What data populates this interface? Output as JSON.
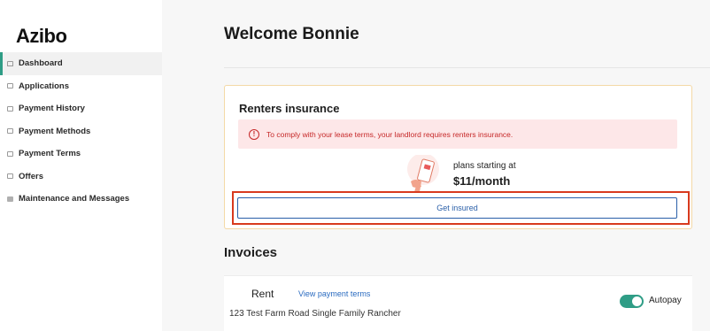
{
  "brand": {
    "logo": "Azibo"
  },
  "sidebar": {
    "items": [
      {
        "label": "Dashboard",
        "icon": "home-icon"
      },
      {
        "label": "Applications",
        "icon": "document-icon"
      },
      {
        "label": "Payment History",
        "icon": "receipt-icon"
      },
      {
        "label": "Payment Methods",
        "icon": "card-icon"
      },
      {
        "label": "Payment Terms",
        "icon": "terms-icon"
      },
      {
        "label": "Offers",
        "icon": "gift-icon"
      },
      {
        "label": "Maintenance and Messages",
        "icon": "message-icon"
      }
    ]
  },
  "header": {
    "welcome": "Welcome Bonnie"
  },
  "renters": {
    "title": "Renters insurance",
    "alert": "To comply with your lease terms, your landlord requires renters insurance.",
    "plans_small": "plans starting at",
    "plans_price": "$11/month",
    "button": "Get insured"
  },
  "invoices": {
    "title": "Invoices",
    "rent_label": "Rent",
    "view_terms": "View payment terms",
    "address": "123 Test Farm Road Single Family Rancher",
    "autopay_label": "Autopay",
    "autopay_on": true
  },
  "colors": {
    "accent": "#2f9d86",
    "alert_text": "#c62828",
    "alert_bg": "#fde7e8",
    "link": "#2a6bc0",
    "highlight": "#d83a1e"
  }
}
